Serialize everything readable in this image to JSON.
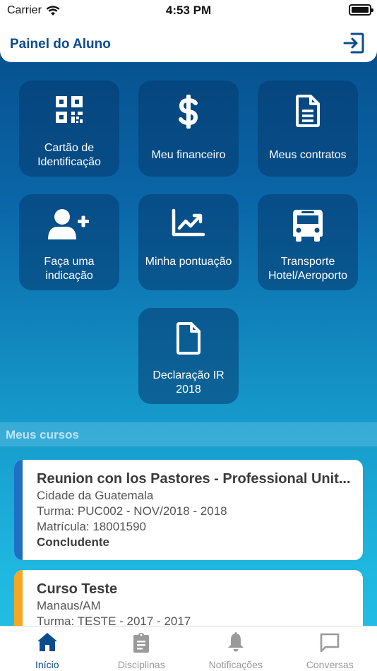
{
  "status_bar": {
    "carrier": "Carrier",
    "time": "4:53 PM"
  },
  "header": {
    "title": "Painel do Aluno",
    "logout_icon": "sign-out-icon"
  },
  "tiles": [
    {
      "label": "Cartão de Identificação",
      "icon": "qr-code-icon"
    },
    {
      "label": "Meu financeiro",
      "icon": "dollar-icon"
    },
    {
      "label": "Meus contratos",
      "icon": "document-icon"
    },
    {
      "label": "Faça uma indicação",
      "icon": "user-plus-icon"
    },
    {
      "label": "Minha pontuação",
      "icon": "chart-line-icon"
    },
    {
      "label": "Transporte Hotel/Aeroporto",
      "icon": "bus-icon"
    },
    {
      "label": "Declaração IR 2018",
      "icon": "file-icon"
    }
  ],
  "section": {
    "title": "Meus cursos"
  },
  "courses": [
    {
      "name": "Reunion con los Pastores - Professional Unit...",
      "city": "Cidade da Guatemala",
      "turma": "Turma: PUC002 - NOV/2018 - 2018",
      "matricula": "Matrícula: 18001590",
      "status": "Concludente",
      "accent_color": "#1f6fc4"
    },
    {
      "name": "Curso Teste",
      "city": "Manaus/AM",
      "turma": "Turma: TESTE - 2017 - 2017",
      "accent_color": "#f5a623"
    }
  ],
  "tabbar": {
    "items": [
      {
        "label": "Início",
        "icon": "home-icon",
        "active": true
      },
      {
        "label": "Disciplinas",
        "icon": "clipboard-icon",
        "active": false
      },
      {
        "label": "Notificações",
        "icon": "bell-icon",
        "active": false
      },
      {
        "label": "Conversas",
        "icon": "chat-icon",
        "active": false
      }
    ]
  },
  "colors": {
    "brand": "#0b4c8f",
    "tile_bg": "#0a4a85",
    "active_tab": "#0b4c8f"
  }
}
